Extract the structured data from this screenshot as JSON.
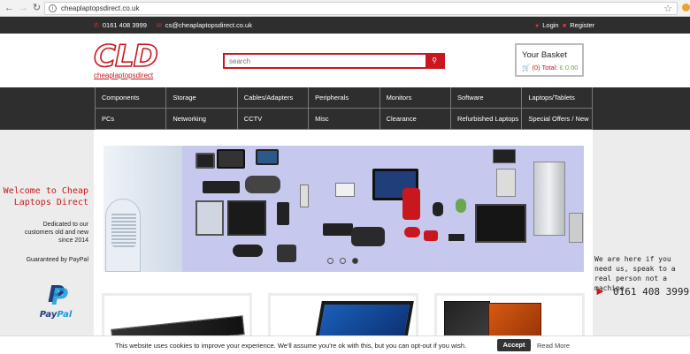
{
  "browser": {
    "url": "cheaplaptopsdirect.co.uk",
    "back_icon": "arrow-left-icon",
    "forward_icon": "arrow-right-icon",
    "reload_icon": "reload-icon"
  },
  "topbar": {
    "phone": "0161 408 3999",
    "email": "cs@cheaplaptopsdirect.co.uk",
    "login": "Login",
    "register": "Register"
  },
  "header": {
    "logo_letters": "CLD",
    "logo_sub": "cheaplaptopsdirect",
    "search_placeholder": "search",
    "basket_title": "Your Basket",
    "basket_count": "(0) Total:",
    "basket_amount": "£ 0.00"
  },
  "menu": {
    "items": [
      "Components",
      "Storage",
      "Cables/Adapters",
      "Peripherals",
      "Monitors",
      "Software",
      "Laptops/Tablets",
      "PCs",
      "Networking",
      "CCTV",
      "Misc",
      "Clearance",
      "Refurbished Laptops",
      "Special Offers / New"
    ]
  },
  "welcome": {
    "heading_line1": "Welcome to Cheap",
    "heading_line2": "Laptops Direct",
    "para": "Dedicated to our customers old and new since 2014",
    "guarantee": "Guaranteed by PayPal",
    "paypal_pay": "Pay",
    "paypal_pal": "Pal"
  },
  "help": {
    "text": "We are here if you need us, speak to a real person not a machine",
    "phone": "0161 408 3999"
  },
  "slider": {
    "active_index": 2,
    "dot_count": 3
  },
  "cookie": {
    "message": "This website uses cookies to improve your experience. We'll assume you're ok with this, but you can opt-out if you wish.",
    "accept": "Accept",
    "read_more": "Read More"
  },
  "colors": {
    "brand_red": "#c8181e",
    "dark_bar": "#2e2e2e",
    "paypal_blue": "#179bd7"
  }
}
